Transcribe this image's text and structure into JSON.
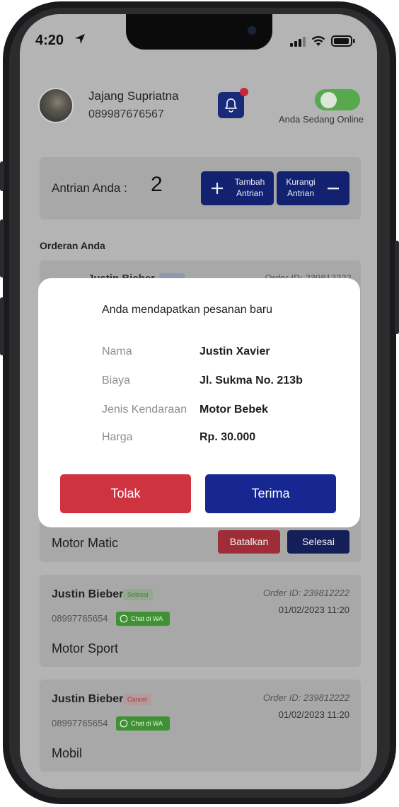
{
  "status_bar": {
    "time": "4:20"
  },
  "profile": {
    "name": "Jajang Supriatna",
    "phone": "089987676567",
    "online_label": "Anda Sedang Online"
  },
  "queue": {
    "label": "Antrian Anda :",
    "count": "2",
    "add_line1": "Tambah",
    "add_line2": "Antrian",
    "reduce_line1": "Kurangi",
    "reduce_line2": "Antrian"
  },
  "orders_title": "Orderan Anda",
  "peek_order": {
    "name": "Justin Bieber",
    "order_id": "Order ID: 239812222"
  },
  "modal": {
    "title": "Anda mendapatkan pesanan baru",
    "rows": [
      {
        "label": "Nama",
        "value": "Justin Xavier"
      },
      {
        "label": "Biaya",
        "value": "Jl. Sukma No. 213b"
      },
      {
        "label": "Jenis Kendaraan",
        "value": "Motor Bebek"
      },
      {
        "label": "Harga",
        "value": "Rp. 30.000"
      }
    ],
    "reject_label": "Tolak",
    "accept_label": "Terima"
  },
  "active_order": {
    "vehicle": "Motor Matic",
    "cancel_label": "Batalkan",
    "finish_label": "Selesai"
  },
  "orders": [
    {
      "name": "Justin Bieber",
      "status": "Selesai",
      "phone": "08997765654",
      "wa_label": "Chat di WA",
      "order_id": "Order ID: 239812222",
      "date": "01/02/2023 11:20",
      "vehicle": "Motor Sport"
    },
    {
      "name": "Justin Bieber",
      "status": "Cancel",
      "phone": "08997765654",
      "wa_label": "Chat di WA",
      "order_id": "Order ID: 239812222",
      "date": "01/02/2023 11:20",
      "vehicle": "Mobil"
    }
  ],
  "colors": {
    "primary": "#172792",
    "danger": "#cf3340",
    "success": "#58a84e",
    "overlay": "#b4b4b4"
  },
  "icons": [
    "location-arrow-icon",
    "signal-icon",
    "wifi-icon",
    "battery-icon",
    "bell-icon",
    "plus-icon",
    "minus-icon",
    "whatsapp-icon"
  ]
}
